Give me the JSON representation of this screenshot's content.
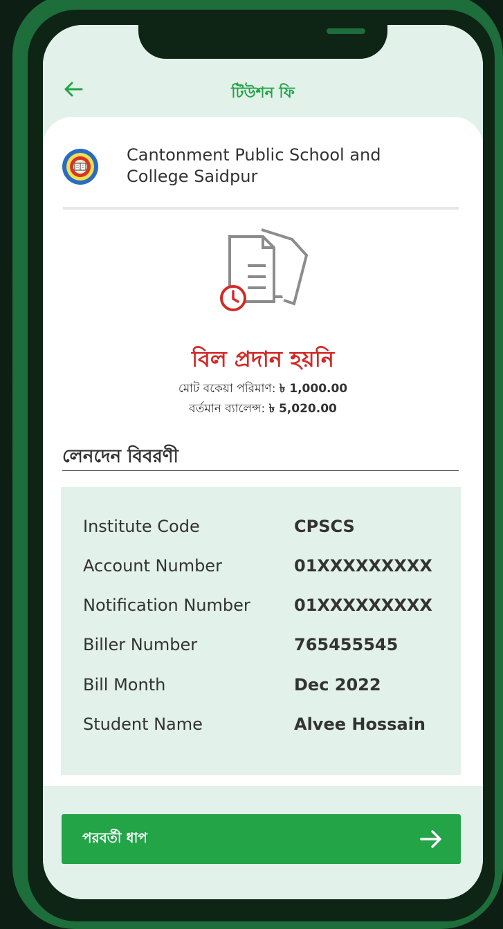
{
  "header": {
    "title": "টিউশন ফি"
  },
  "school": {
    "name": "Cantonment Public School and College Saidpur"
  },
  "status": {
    "title": "বিল প্রদান হয়নি",
    "due_label": "মোট বকেয়া পরিমাণ:",
    "due_value": "৳ 1,000.00",
    "balance_label": "বর্তমান ব্যালেন্স:",
    "balance_value": "৳ 5,020.00"
  },
  "details": {
    "heading": "লেনদেন বিবরণী",
    "rows": [
      {
        "label": "Institute Code",
        "value": "CPSCS"
      },
      {
        "label": "Account Number",
        "value": "01XXXXXXXXX"
      },
      {
        "label": "Notification Number",
        "value": "01XXXXXXXXX"
      },
      {
        "label": "Biller Number",
        "value": "765455545"
      },
      {
        "label": "Bill Month",
        "value": "Dec 2022"
      },
      {
        "label": "Student Name",
        "value": "Alvee Hossain"
      }
    ]
  },
  "footer": {
    "next_label": "পরবর্তী ধাপ"
  },
  "colors": {
    "accent": "#22a447",
    "alert": "#d32a27",
    "panel": "#e2f1ea",
    "frame": "#1d6e3a"
  },
  "icons": {
    "back": "arrow-left-icon",
    "document": "document-clock-icon",
    "next": "arrow-right-icon"
  }
}
